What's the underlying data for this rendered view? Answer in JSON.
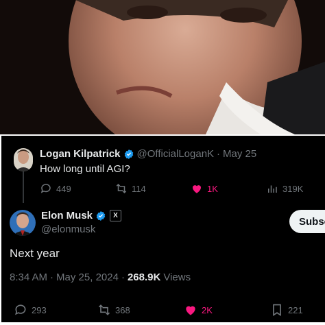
{
  "photo": {
    "alt_subject": "portrait-photo"
  },
  "original_post": {
    "author_name": "Logan Kilpatrick",
    "handle": "@OfficialLoganK",
    "separator": "·",
    "date": "May 25",
    "text": "How long until AGI?",
    "replies": "449",
    "reposts": "114",
    "likes": "1K",
    "views": "319K"
  },
  "reply_post": {
    "author_name": "Elon Musk",
    "handle": "@elonmusk",
    "affiliate_badge": "X",
    "subscribe_label": "Subsc",
    "text": "Next year",
    "time": "8:34 AM",
    "separator": "·",
    "date": "May 25, 2024",
    "separator2": "·",
    "views_count": "268.9K",
    "views_label": "Views",
    "replies": "293",
    "reposts": "368",
    "likes": "2K",
    "bookmarks": "221"
  },
  "colors": {
    "background": "#000000",
    "text": "#e7e9ea",
    "muted": "#71767b",
    "like": "#f91880",
    "verified": "#1d9bf0"
  }
}
